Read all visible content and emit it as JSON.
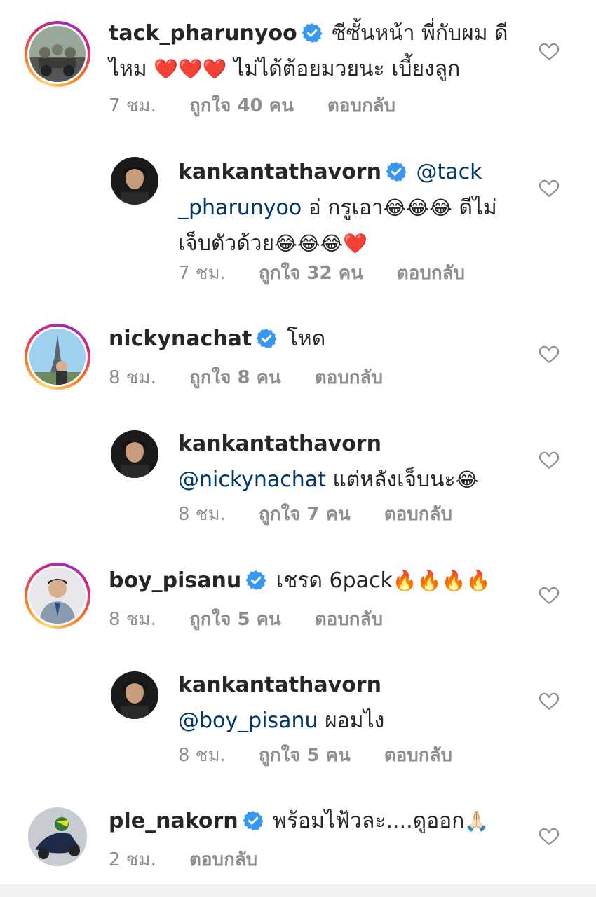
{
  "comments": [
    {
      "username": "tack_pharunyoo",
      "text_parts": [
        "ซีซั้นหน้า พี่กับผม ดี",
        "ไหม ",
        "❤️❤️❤️",
        " ไม่ได้ต้อยมวยนะ เบี้ยงลูก"
      ],
      "time": "7 ชม.",
      "likes": "ถูกใจ 40 คน",
      "reply": "ตอบกลับ"
    },
    {
      "username": "kankantathavorn",
      "mention": "@tack",
      "text_parts": [
        "_pharunyoo",
        " อ่ กรูเอา",
        "😂😂😂",
        " ดีไม่",
        "เจ็บตัวด้วย",
        "😂😂😂❤️"
      ],
      "time": "7 ชม.",
      "likes": "ถูกใจ 32 คน",
      "reply": "ตอบกลับ"
    },
    {
      "username": "nickynachat",
      "text": "โหด",
      "time": "8 ชม.",
      "likes": "ถูกใจ 8 คน",
      "reply": "ตอบกลับ"
    },
    {
      "username": "kankantathavorn",
      "mention": "@nickynachat",
      "text": " แต่หลังเจ็บนะ",
      "emoji": "😂",
      "time": "8 ชม.",
      "likes": "ถูกใจ 7 คน",
      "reply": "ตอบกลับ"
    },
    {
      "username": "boy_pisanu",
      "text": "เชรด 6pack",
      "emoji": "🔥🔥🔥🔥",
      "time": "8 ชม.",
      "likes": "ถูกใจ 5 คน",
      "reply": "ตอบกลับ"
    },
    {
      "username": "kankantathavorn",
      "mention": "@boy_pisanu",
      "text": " ผอมไง",
      "time": "8 ชม.",
      "likes": "ถูกใจ 5 คน",
      "reply": "ตอบกลับ"
    },
    {
      "username": "ple_nakorn",
      "text": "พร้อมไฟ้วละ....ดูออก",
      "emoji": "🙏🏻",
      "time": "2 ชม.",
      "reply": "ตอบกลับ"
    }
  ],
  "colors": {
    "text": "#262626",
    "meta": "#8e8e8e",
    "mention": "#00376b",
    "verified": "#3897f0"
  },
  "icons": [
    "verified-badge-icon",
    "heart-outline-icon"
  ]
}
